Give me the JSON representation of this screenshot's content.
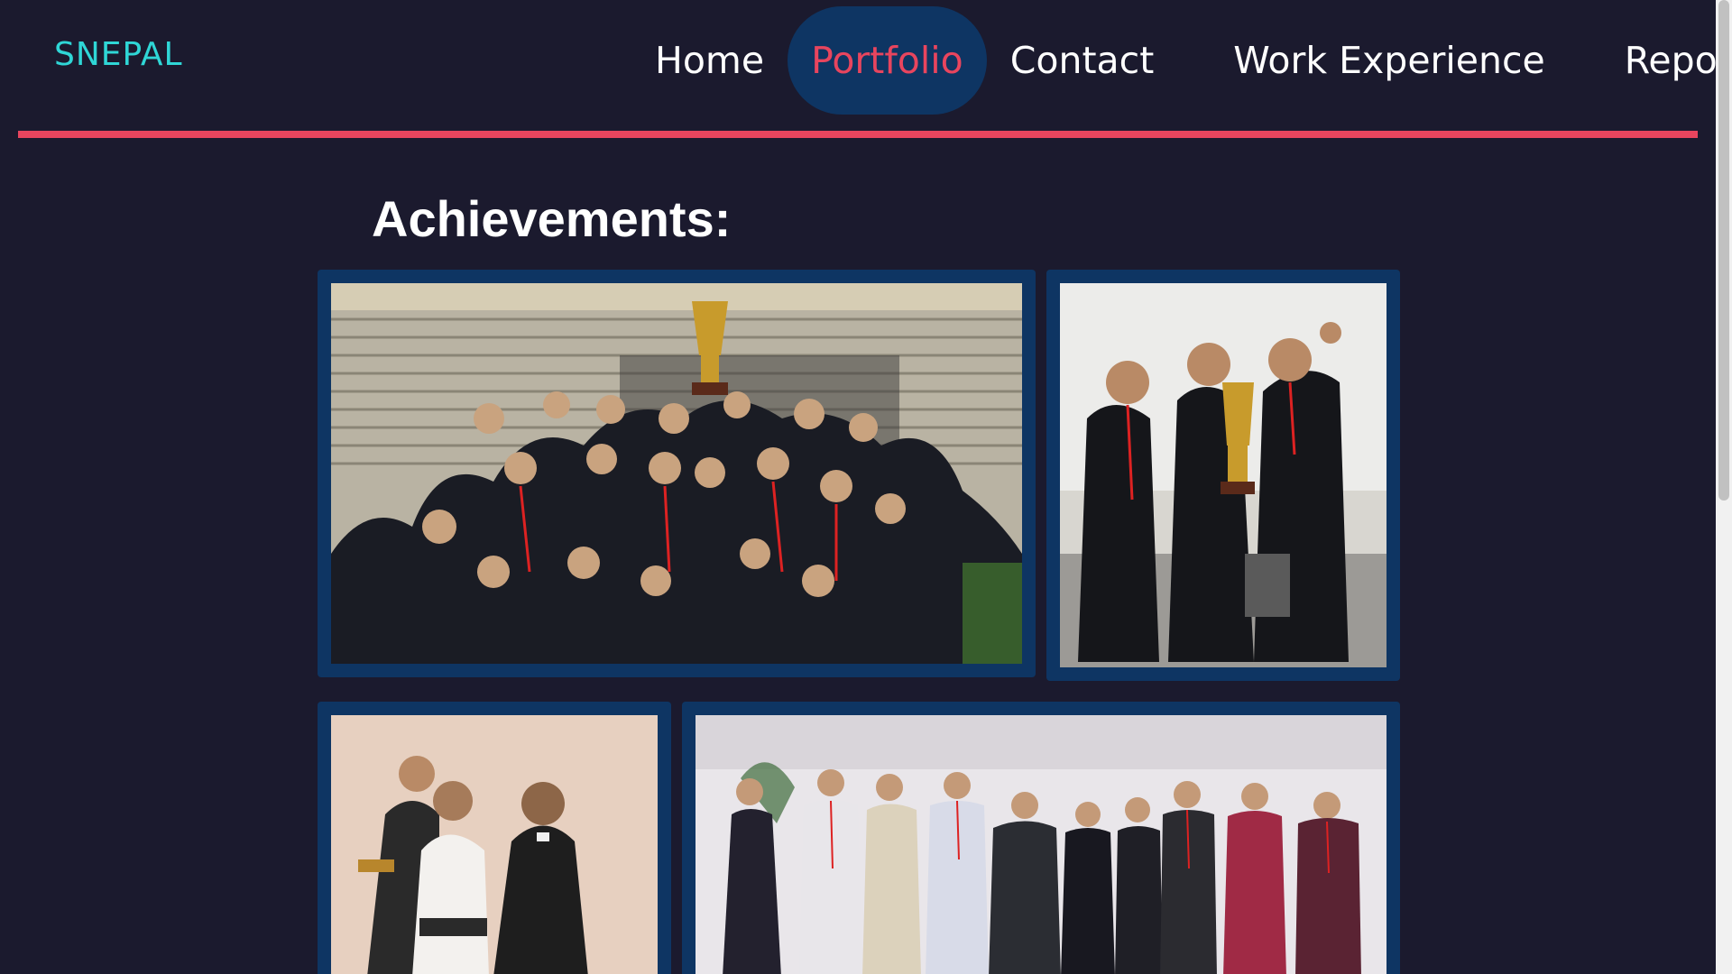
{
  "header": {
    "logo": "SNEPAL",
    "nav": [
      {
        "label": "Home",
        "active": false
      },
      {
        "label": "Portfolio",
        "active": true
      },
      {
        "label": "Contact",
        "active": false
      },
      {
        "label": "Work Experience",
        "active": false
      },
      {
        "label": "Report",
        "active": false
      }
    ]
  },
  "colors": {
    "background": "#1b1a2e",
    "accent": "#e8455e",
    "logo": "#2fd6d6",
    "frame": "#0e3563"
  },
  "main": {
    "title": "Achievements:",
    "photos": [
      {
        "icon": "group-trophy-photo"
      },
      {
        "icon": "trophy-trio-photo"
      },
      {
        "icon": "award-handshake-photo"
      },
      {
        "icon": "team-lineup-photo"
      }
    ]
  }
}
